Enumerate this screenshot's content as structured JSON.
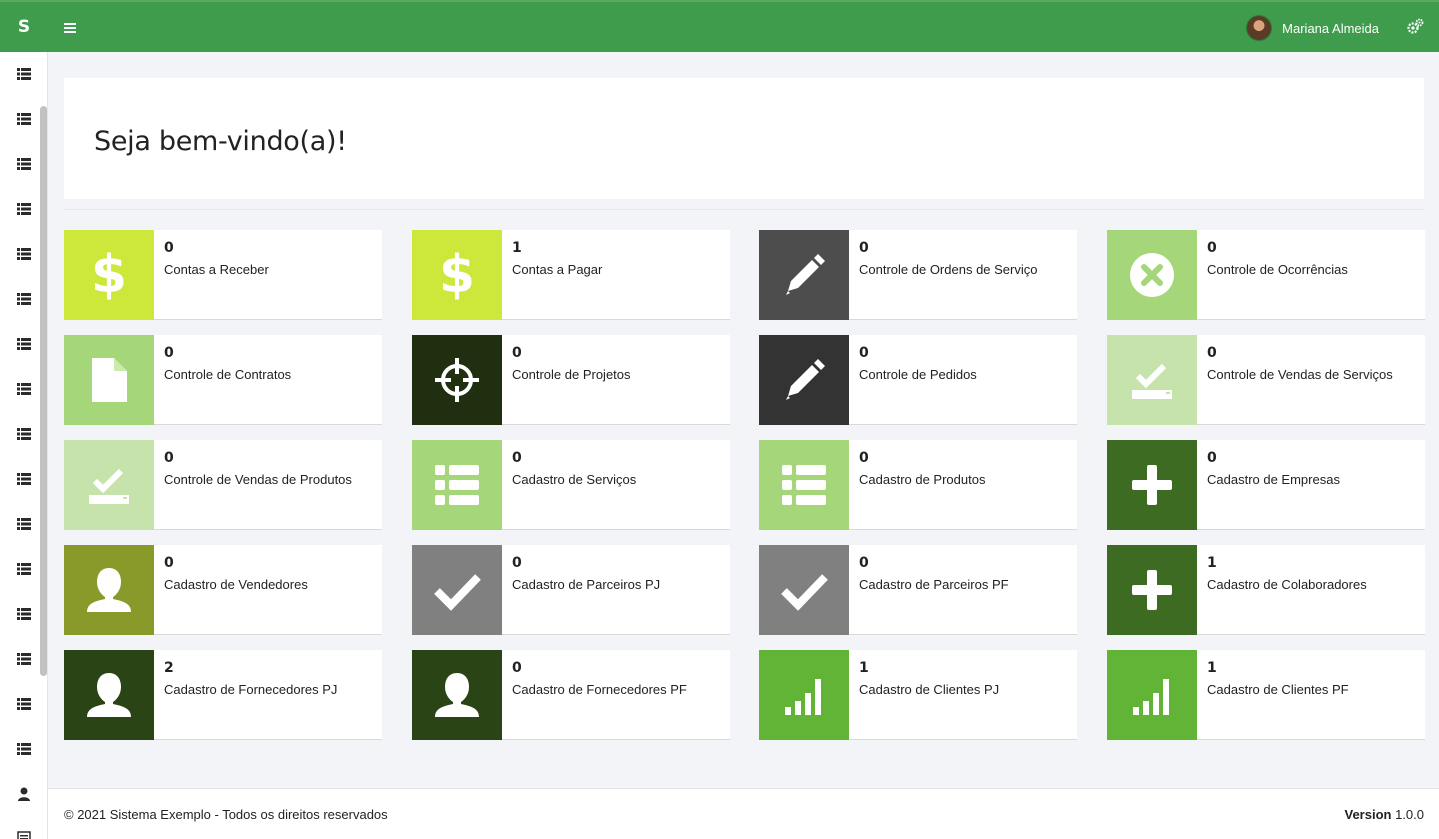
{
  "header": {
    "brand": "S",
    "user_name": "Mariana Almeida",
    "accent_color": "#3e9c4c"
  },
  "sidebar": {
    "items": [
      {
        "icon": "list-icon"
      },
      {
        "icon": "list-icon"
      },
      {
        "icon": "list-icon"
      },
      {
        "icon": "list-icon"
      },
      {
        "icon": "list-icon"
      },
      {
        "icon": "list-icon"
      },
      {
        "icon": "list-icon"
      },
      {
        "icon": "list-icon"
      },
      {
        "icon": "list-icon"
      },
      {
        "icon": "list-icon"
      },
      {
        "icon": "list-icon"
      },
      {
        "icon": "list-icon"
      },
      {
        "icon": "list-icon"
      },
      {
        "icon": "list-icon"
      },
      {
        "icon": "list-icon"
      },
      {
        "icon": "list-icon"
      },
      {
        "icon": "user-icon"
      },
      {
        "icon": "document-icon"
      }
    ]
  },
  "main": {
    "welcome": "Seja bem-vindo(a)!",
    "cards": [
      {
        "count": "0",
        "label": "Contas a Receber",
        "icon": "dollar-icon",
        "color": "#cde83a"
      },
      {
        "count": "1",
        "label": "Contas a Pagar",
        "icon": "dollar-icon",
        "color": "#cde83a"
      },
      {
        "count": "0",
        "label": "Controle de Ordens de Serviço",
        "icon": "pencil-icon",
        "color": "#4d4d4d"
      },
      {
        "count": "0",
        "label": "Controle de Ocorrências",
        "icon": "close-circle-icon",
        "color": "#a5d77a"
      },
      {
        "count": "0",
        "label": "Controle de Contratos",
        "icon": "file-icon",
        "color": "#a5d77a"
      },
      {
        "count": "0",
        "label": "Controle de Projetos",
        "icon": "crosshair-icon",
        "color": "#1f2f0f"
      },
      {
        "count": "0",
        "label": "Controle de Pedidos",
        "icon": "pencil-icon",
        "color": "#333333"
      },
      {
        "count": "0",
        "label": "Controle de Vendas de Serviços",
        "icon": "check-tray-icon",
        "color": "#c5e3aa"
      },
      {
        "count": "0",
        "label": "Controle de Vendas de Produtos",
        "icon": "check-tray-icon",
        "color": "#c5e3aa"
      },
      {
        "count": "0",
        "label": "Cadastro de Serviços",
        "icon": "list-icon",
        "color": "#a5d77a"
      },
      {
        "count": "0",
        "label": "Cadastro de Produtos",
        "icon": "list-icon",
        "color": "#a5d77a"
      },
      {
        "count": "0",
        "label": "Cadastro de Empresas",
        "icon": "plus-icon",
        "color": "#3e6b22"
      },
      {
        "count": "0",
        "label": "Cadastro de Vendedores",
        "icon": "user-icon",
        "color": "#8a9a2a"
      },
      {
        "count": "0",
        "label": "Cadastro de Parceiros PJ",
        "icon": "check-icon",
        "color": "#808080"
      },
      {
        "count": "0",
        "label": "Cadastro de Parceiros PF",
        "icon": "check-icon",
        "color": "#808080"
      },
      {
        "count": "1",
        "label": "Cadastro de Colaboradores",
        "icon": "plus-icon",
        "color": "#3e6b22"
      },
      {
        "count": "2",
        "label": "Cadastro de Fornecedores PJ",
        "icon": "user-icon",
        "color": "#2a4416"
      },
      {
        "count": "0",
        "label": "Cadastro de Fornecedores PF",
        "icon": "user-icon",
        "color": "#2a4416"
      },
      {
        "count": "1",
        "label": "Cadastro de Clientes PJ",
        "icon": "signal-icon",
        "color": "#62b436"
      },
      {
        "count": "1",
        "label": "Cadastro de Clientes PF",
        "icon": "signal-icon",
        "color": "#62b436"
      }
    ]
  },
  "footer": {
    "copyright": "© 2021 Sistema Exemplo - Todos os direitos reservados",
    "version_label": "Version",
    "version": "1.0.0"
  }
}
